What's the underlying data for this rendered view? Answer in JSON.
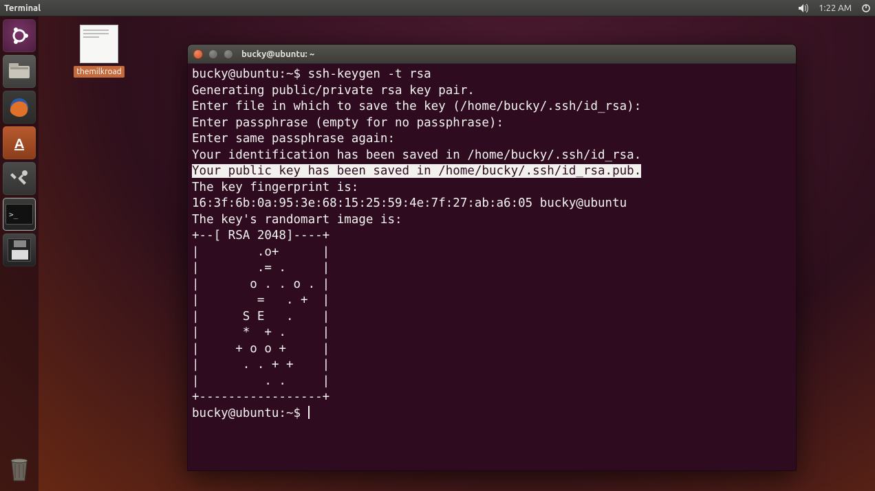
{
  "panel": {
    "app_label": "Terminal",
    "clock": "1:22 AM"
  },
  "launcher": {
    "items": [
      {
        "name": "dash-icon"
      },
      {
        "name": "files-icon"
      },
      {
        "name": "firefox-icon"
      },
      {
        "name": "software-center-icon",
        "glyph": "A"
      },
      {
        "name": "settings-icon"
      },
      {
        "name": "terminal-icon",
        "glyph": ">_"
      },
      {
        "name": "save-icon"
      }
    ],
    "trash_name": "trash-icon"
  },
  "desktop": {
    "icon_label": "themilkroad"
  },
  "terminal": {
    "title": "bucky@ubuntu: ~",
    "prompt": "bucky@ubuntu:~$",
    "command": "ssh-keygen -t rsa",
    "lines": {
      "l0": "Generating public/private rsa key pair.",
      "l1": "Enter file in which to save the key (/home/bucky/.ssh/id_rsa):",
      "l2": "Enter passphrase (empty for no passphrase):",
      "l3": "Enter same passphrase again:",
      "l4": "Your identification has been saved in /home/bucky/.ssh/id_rsa.",
      "l5": "Your public key has been saved in /home/bucky/.ssh/id_rsa.pub.",
      "l6": "The key fingerprint is:",
      "l7": "16:3f:6b:0a:95:3e:68:15:25:59:4e:7f:27:ab:a6:05 bucky@ubuntu",
      "l8": "The key's randomart image is:",
      "r0": "+--[ RSA 2048]----+",
      "r1": "|        .o+      |",
      "r2": "|        .= .     |",
      "r3": "|       o . . o . |",
      "r4": "|        =   . +  |",
      "r5": "|      S E   .    |",
      "r6": "|      *  + .     |",
      "r7": "|     + o o +     |",
      "r8": "|      . . + +    |",
      "r9": "|         . .     |",
      "r10": "+-----------------+"
    },
    "prompt2": "bucky@ubuntu:~$"
  }
}
